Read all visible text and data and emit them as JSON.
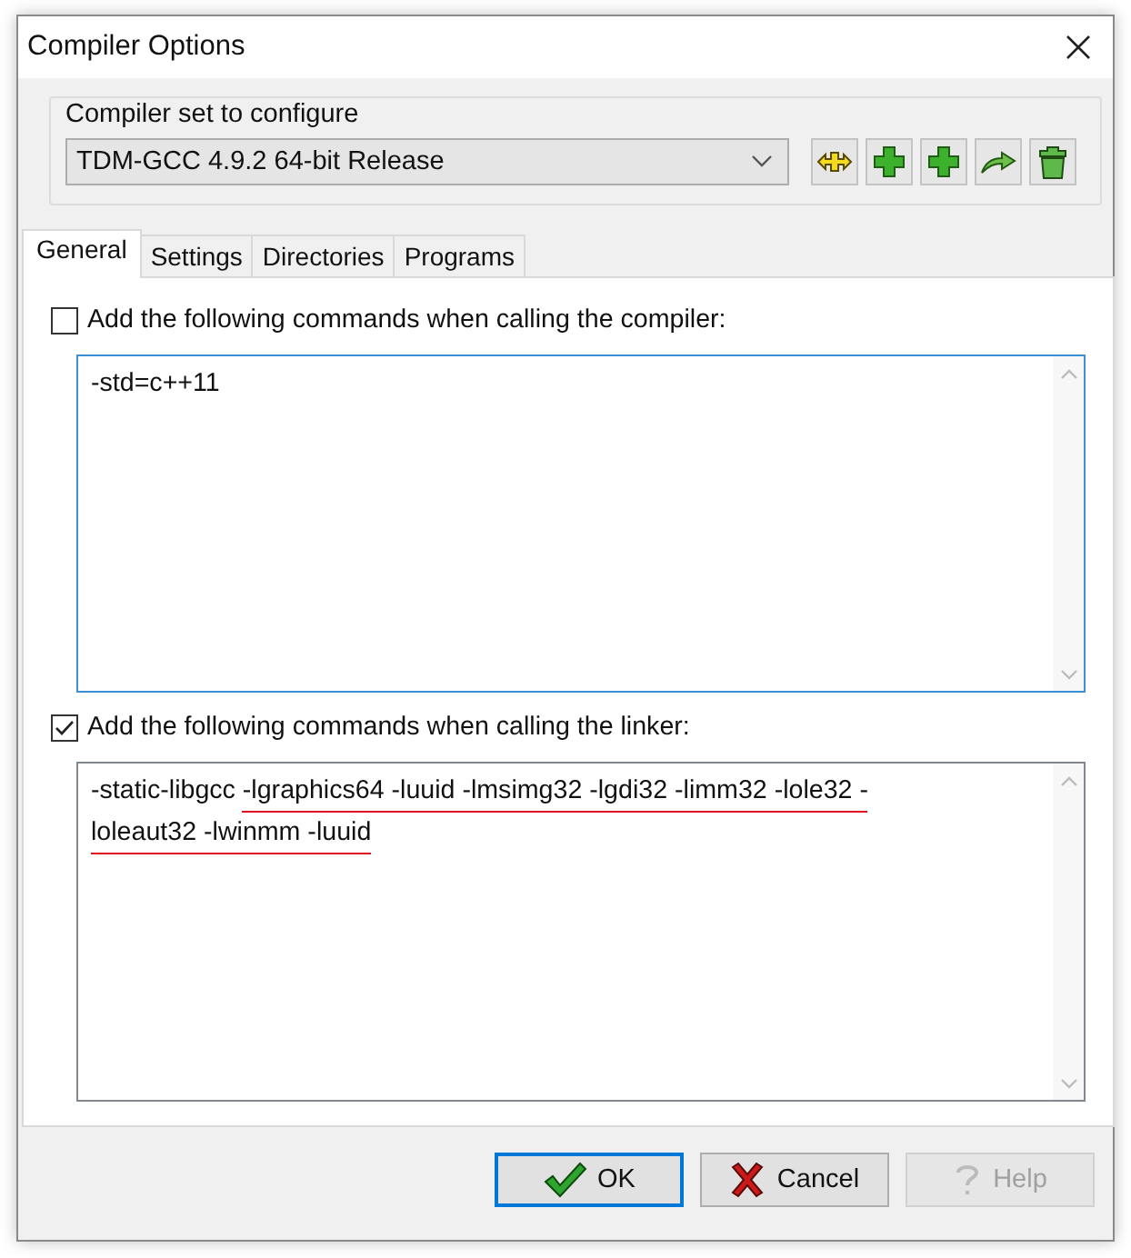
{
  "window": {
    "title": "Compiler Options"
  },
  "compiler_set": {
    "label": "Compiler set to configure",
    "value": "TDM-GCC 4.9.2 64-bit Release"
  },
  "tabs": [
    {
      "label": "General",
      "selected": true
    },
    {
      "label": "Settings",
      "selected": false
    },
    {
      "label": "Directories",
      "selected": false
    },
    {
      "label": "Programs",
      "selected": false
    }
  ],
  "compiler_commands": {
    "label": "Add the following commands when calling the compiler:",
    "checked": false,
    "focused": true,
    "value": [
      {
        "text": "-std=c++11",
        "underlined": false
      }
    ]
  },
  "linker_commands": {
    "label": "Add the following commands when calling the linker:",
    "checked": true,
    "focused": false,
    "value": [
      {
        "text": "-static-libgcc ",
        "underlined": false
      },
      {
        "text": "-lgraphics64 -luuid -lmsimg32 -lgdi32 -limm32 -lole32 -loleaut32 -lwinmm -luuid",
        "underlined": true
      }
    ]
  },
  "buttons": [
    {
      "label": "OK",
      "kind": "ok",
      "default": true,
      "disabled": false
    },
    {
      "label": "Cancel",
      "kind": "cancel",
      "default": false,
      "disabled": false
    },
    {
      "label": "Help",
      "kind": "help",
      "default": false,
      "disabled": true
    }
  ]
}
